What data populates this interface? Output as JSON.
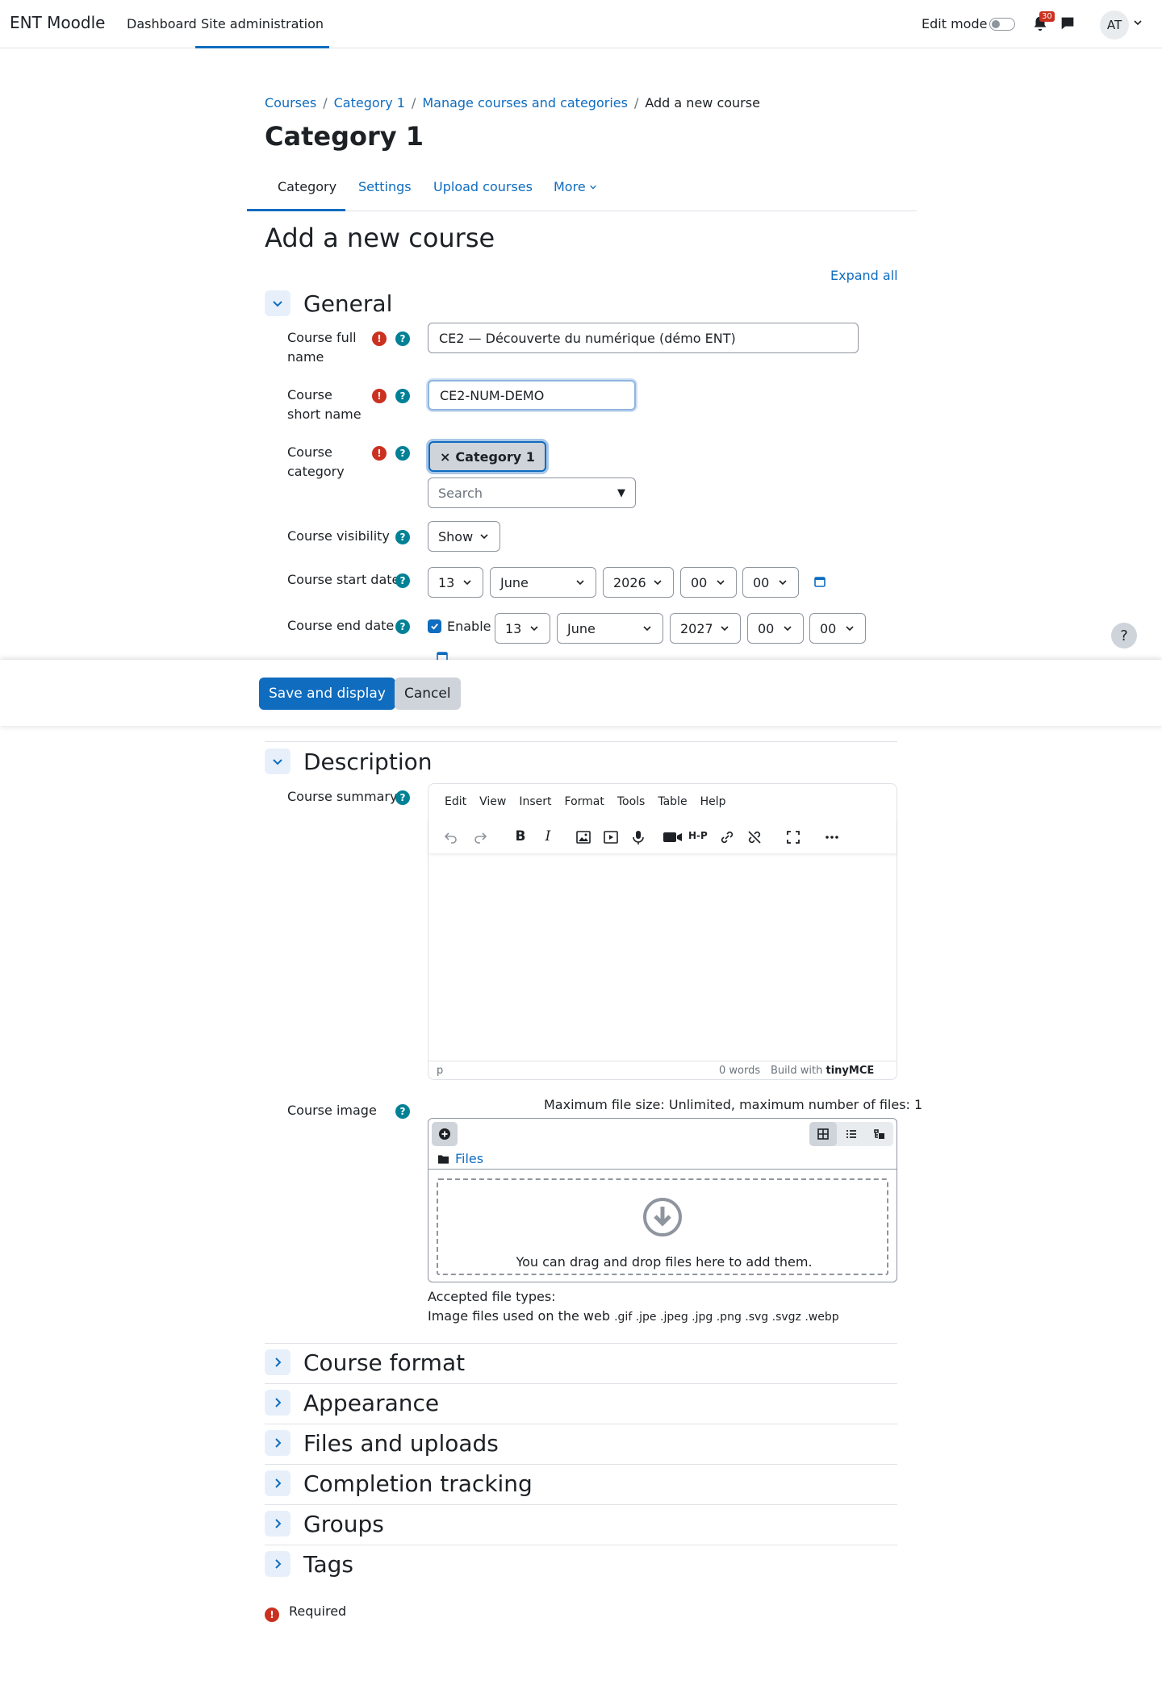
{
  "navbar": {
    "brand": "ENT Moodle",
    "links": [
      "Dashboard",
      "Site administration"
    ],
    "edit_mode_label": "Edit mode",
    "notification_count": "30",
    "avatar_initials": "AT"
  },
  "breadcrumb": [
    "Courses",
    "Category 1",
    "Manage courses and categories",
    "Add a new course"
  ],
  "page_title": "Category 1",
  "tabs": [
    "Category",
    "Settings",
    "Upload courses",
    "More"
  ],
  "form_title": "Add a new course",
  "expand_all": "Expand all",
  "sections": {
    "general": "General",
    "description": "Description",
    "collapsed": [
      "Course format",
      "Appearance",
      "Files and uploads",
      "Completion tracking",
      "Groups",
      "Tags"
    ]
  },
  "fields": {
    "fullname_label": "Course full name",
    "fullname_value": "CE2 — Découverte du numérique (démo ENT)",
    "shortname_label": "Course short name",
    "shortname_value": "CE2-NUM-DEMO",
    "category_label": "Course category",
    "category_tag": "Category 1",
    "category_search_placeholder": "Search",
    "visibility_label": "Course visibility",
    "visibility_value": "Show",
    "start_label": "Course start date",
    "start": {
      "day": "13",
      "month": "June",
      "year": "2026",
      "hour": "00",
      "minute": "00"
    },
    "end_label": "Course end date",
    "end_enable": "Enable",
    "end": {
      "day": "13",
      "month": "June",
      "year": "2027",
      "hour": "00",
      "minute": "00"
    },
    "summary_label": "Course summary",
    "image_label": "Course image"
  },
  "editor": {
    "menu": [
      "Edit",
      "View",
      "Insert",
      "Format",
      "Tools",
      "Table",
      "Help"
    ],
    "status_path": "p",
    "word_count": "0 words",
    "build_with": "Build with",
    "brand": "tinyMCE"
  },
  "filepicker": {
    "note": "Maximum file size: Unlimited, maximum number of files: 1",
    "path": "Files",
    "drop_text": "You can drag and drop files here to add them.",
    "accepted_title": "Accepted file types:",
    "accepted_desc": "Image files used on the web",
    "accepted_exts": ".gif .jpe .jpeg .jpg .png .svg .svgz .webp"
  },
  "buttons": {
    "save": "Save and display",
    "cancel": "Cancel"
  },
  "required_note": "Required",
  "colors": {
    "primary": "#0f6cbf",
    "required": "#ca3120",
    "help": "#008196"
  }
}
